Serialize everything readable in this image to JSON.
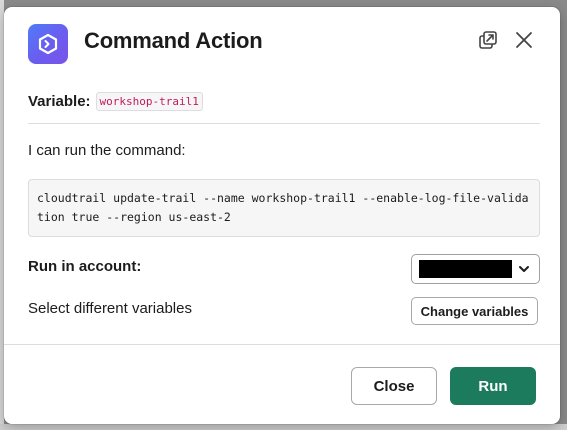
{
  "modal": {
    "title": "Command Action",
    "app_icon": "app-logo-icon",
    "accent_color": "#1d7b5d"
  },
  "header_actions": {
    "popout_icon": "popout-icon",
    "close_icon": "close-icon"
  },
  "variable": {
    "label": "Variable:",
    "value": "workshop-trail1"
  },
  "command": {
    "intro": "I can run the command:",
    "text": "cloudtrail update-trail --name workshop-trail1 --enable-log-file-validation true --region us-east-2"
  },
  "account": {
    "label": "Run in account:",
    "selected": "",
    "chevron_icon": "chevron-down-icon"
  },
  "variables_action": {
    "label": "Select different variables",
    "button_label": "Change variables"
  },
  "footer": {
    "close_label": "Close",
    "run_label": "Run"
  }
}
